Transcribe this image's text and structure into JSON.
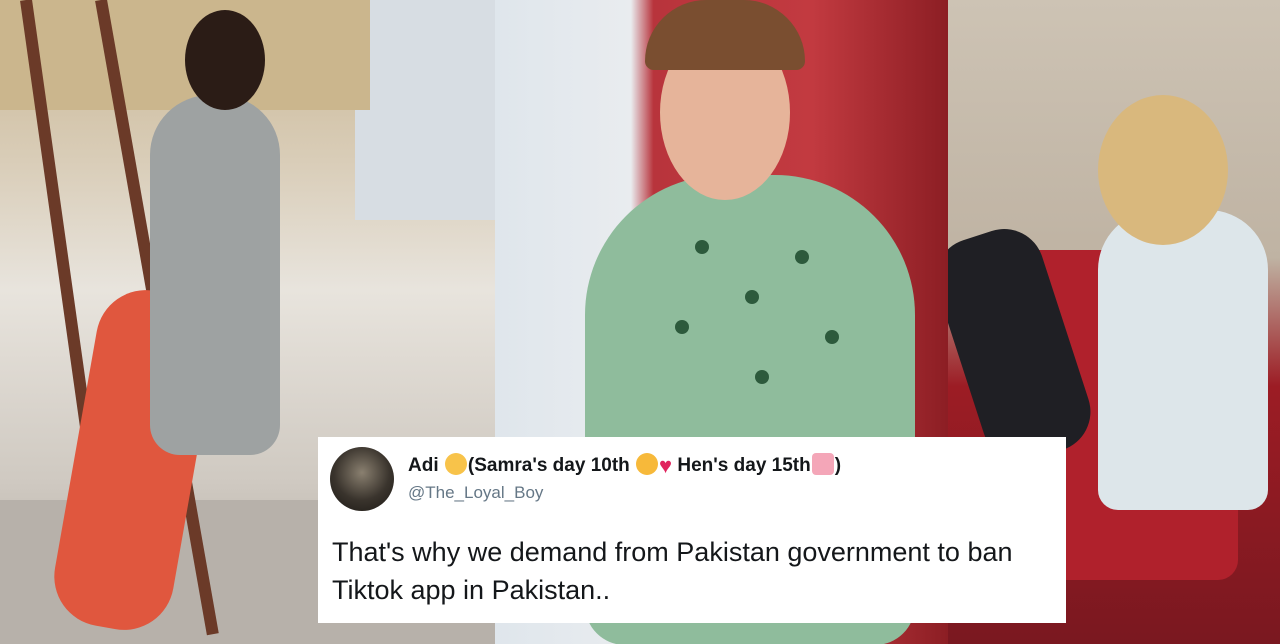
{
  "tweet": {
    "display_name_prefix": "Adi",
    "display_name_part1": "(Samra's day 10th",
    "display_name_part2": "Hen's day 15th",
    "display_name_suffix": ")",
    "handle": "@The_Loyal_Boy",
    "text": "That's why we demand from Pakistan government to ban Tiktok app in Pakistan..",
    "icons": [
      "emoji-face-icon",
      "heart-eyes-emoji-icon",
      "red-heart-emoji-icon",
      "birthday-cake-emoji-icon"
    ]
  },
  "colors": {
    "card_bg": "#ffffff",
    "text": "#14171a",
    "handle": "#657786",
    "heart": "#e0245e"
  }
}
